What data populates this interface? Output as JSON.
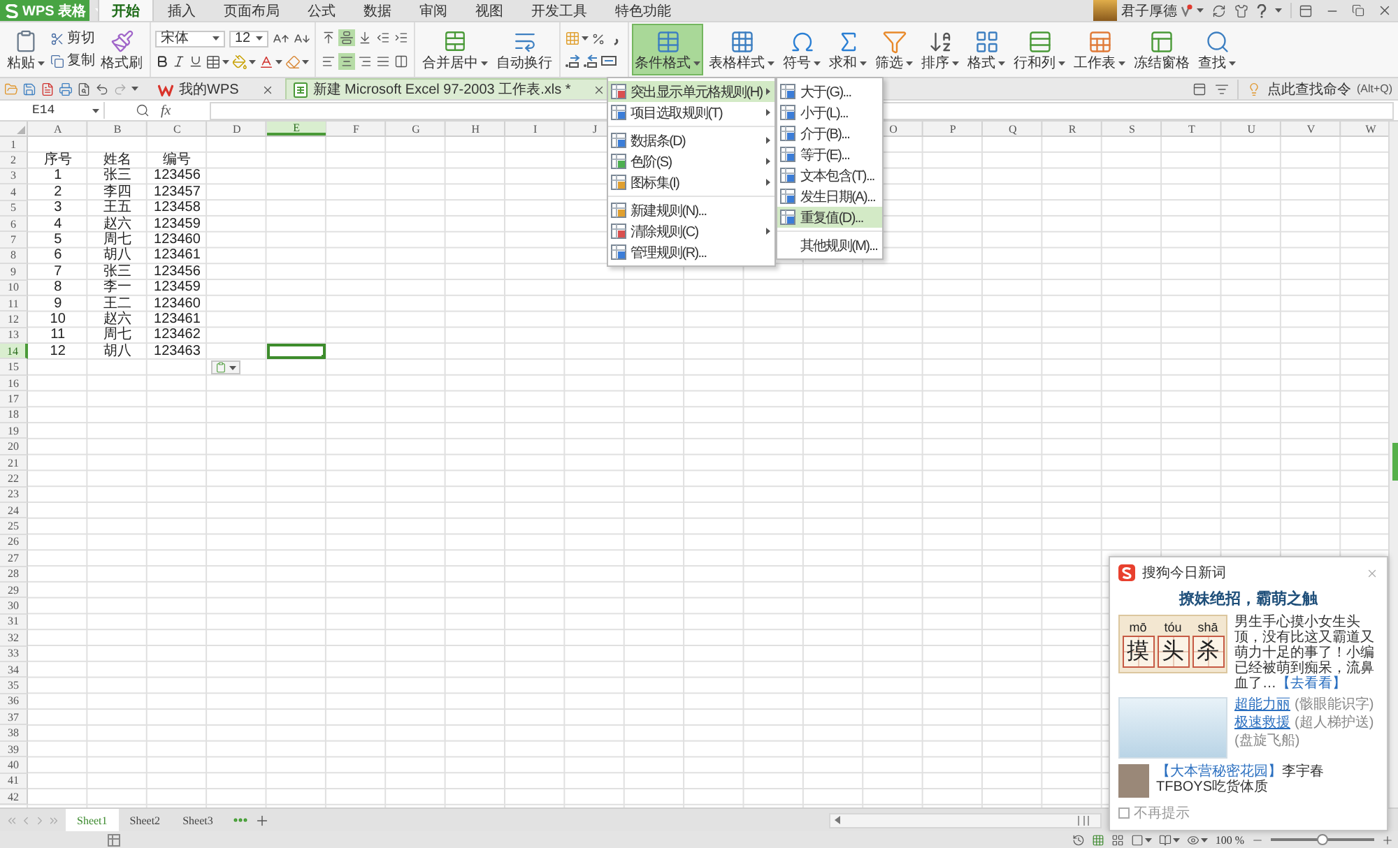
{
  "app_button": {
    "label": "WPS 表格"
  },
  "menu_tabs": [
    {
      "label": "开始",
      "selected": true
    },
    {
      "label": "插入",
      "selected": false
    },
    {
      "label": "页面布局",
      "selected": false
    },
    {
      "label": "公式",
      "selected": false
    },
    {
      "label": "数据",
      "selected": false
    },
    {
      "label": "审阅",
      "selected": false
    },
    {
      "label": "视图",
      "selected": false
    },
    {
      "label": "开发工具",
      "selected": false
    },
    {
      "label": "特色功能",
      "selected": false
    }
  ],
  "account": {
    "name": "君子厚德"
  },
  "ribbon": {
    "paste": "粘贴",
    "cut": "剪切",
    "copy": "复制",
    "format_painter": "格式刷",
    "font_name": "宋体",
    "font_size": "12",
    "alignment_rows": [
      {
        "buttons": [
          {
            "kind": "top",
            "selected": false
          },
          {
            "kind": "middle",
            "selected": true
          },
          {
            "kind": "bottom",
            "selected": false
          },
          {
            "kind": "outdent",
            "selected": false
          },
          {
            "kind": "indent",
            "selected": false
          }
        ]
      },
      {
        "buttons": [
          {
            "kind": "left",
            "selected": false
          },
          {
            "kind": "center",
            "selected": true
          },
          {
            "kind": "right",
            "selected": false
          },
          {
            "kind": "justify",
            "selected": false
          },
          {
            "kind": "distribute",
            "selected": false
          }
        ]
      }
    ],
    "merge": "合并居中",
    "wrap": "自动换行",
    "tools": [
      {
        "kind": "conditional",
        "label": "条件格式",
        "selected": true,
        "dropdown": true
      },
      {
        "kind": "style",
        "label": "表格样式",
        "selected": false,
        "dropdown": true
      },
      {
        "kind": "symbol",
        "label": "符号",
        "selected": false,
        "dropdown": true
      },
      {
        "kind": "sum",
        "label": "求和",
        "selected": false,
        "dropdown": true
      },
      {
        "kind": "filter",
        "label": "筛选",
        "selected": false,
        "dropdown": true
      },
      {
        "kind": "sort",
        "label": "排序",
        "selected": false,
        "dropdown": true
      },
      {
        "kind": "format",
        "label": "格式",
        "selected": false,
        "dropdown": true
      },
      {
        "kind": "rowcol",
        "label": "行和列",
        "selected": false,
        "dropdown": true
      },
      {
        "kind": "sheet",
        "label": "工作表",
        "selected": false,
        "dropdown": true
      },
      {
        "kind": "freeze",
        "label": "冻结窗格",
        "selected": false,
        "dropdown": false
      },
      {
        "kind": "find",
        "label": "查找",
        "selected": false,
        "dropdown": true
      }
    ]
  },
  "doc_tabs": [
    {
      "kind": "home",
      "label": "我的WPS",
      "selected": false
    },
    {
      "kind": "sheet",
      "label": "新建 Microsoft Excel 97-2003 工作表.xls *",
      "selected": true
    }
  ],
  "command_search": {
    "label": "点此查找命令",
    "shortcut": "(Alt+Q)"
  },
  "formula_bar": {
    "cell_name": "E14",
    "function_button": "fx"
  },
  "sheet": {
    "columns_left_of_menu": [
      {
        "label": "A",
        "selected": false
      },
      {
        "label": "B",
        "selected": false
      },
      {
        "label": "C",
        "selected": false
      },
      {
        "label": "D",
        "selected": false
      },
      {
        "label": "E",
        "selected": true
      },
      {
        "label": "F",
        "selected": false
      },
      {
        "label": "G",
        "selected": false
      },
      {
        "label": "H",
        "selected": false
      },
      {
        "label": "I",
        "selected": false
      },
      {
        "label": "J",
        "selected": false
      }
    ],
    "columns_right_of_menu": [
      {
        "label": "O",
        "selected": false
      },
      {
        "label": "P",
        "selected": false
      },
      {
        "label": "Q",
        "selected": false
      },
      {
        "label": "R",
        "selected": false
      },
      {
        "label": "S",
        "selected": false
      },
      {
        "label": "T",
        "selected": false
      },
      {
        "label": "U",
        "selected": false
      },
      {
        "label": "V",
        "selected": false
      },
      {
        "label": "W",
        "selected": false
      }
    ],
    "rows": [
      {
        "number": "1",
        "selected": false
      },
      {
        "number": "2",
        "selected": false,
        "cells": [
          "序号",
          "姓名",
          "编号"
        ]
      },
      {
        "number": "3",
        "selected": false,
        "cells": [
          "1",
          "张三",
          "123456"
        ]
      },
      {
        "number": "4",
        "selected": false,
        "cells": [
          "2",
          "李四",
          "123457"
        ]
      },
      {
        "number": "5",
        "selected": false,
        "cells": [
          "3",
          "王五",
          "123458"
        ]
      },
      {
        "number": "6",
        "selected": false,
        "cells": [
          "4",
          "赵六",
          "123459"
        ]
      },
      {
        "number": "7",
        "selected": false,
        "cells": [
          "5",
          "周七",
          "123460"
        ]
      },
      {
        "number": "8",
        "selected": false,
        "cells": [
          "6",
          "胡八",
          "123461"
        ]
      },
      {
        "number": "9",
        "selected": false,
        "cells": [
          "7",
          "张三",
          "123456"
        ]
      },
      {
        "number": "10",
        "selected": false,
        "cells": [
          "8",
          "李一",
          "123459"
        ]
      },
      {
        "number": "11",
        "selected": false,
        "cells": [
          "9",
          "王二",
          "123460"
        ]
      },
      {
        "number": "12",
        "selected": false,
        "cells": [
          "10",
          "赵六",
          "123461"
        ]
      },
      {
        "number": "13",
        "selected": false,
        "cells": [
          "11",
          "周七",
          "123462"
        ]
      },
      {
        "number": "14",
        "selected": true,
        "cells": [
          "12",
          "胡八",
          "123463"
        ]
      },
      {
        "number": "15",
        "selected": false
      },
      {
        "number": "16",
        "selected": false
      },
      {
        "number": "17",
        "selected": false
      },
      {
        "number": "18",
        "selected": false
      },
      {
        "number": "19",
        "selected": false
      },
      {
        "number": "20",
        "selected": false
      },
      {
        "number": "21",
        "selected": false
      },
      {
        "number": "22",
        "selected": false
      },
      {
        "number": "23",
        "selected": false
      },
      {
        "number": "24",
        "selected": false
      },
      {
        "number": "25",
        "selected": false
      },
      {
        "number": "26",
        "selected": false
      },
      {
        "number": "27",
        "selected": false
      },
      {
        "number": "28",
        "selected": false
      },
      {
        "number": "29",
        "selected": false
      },
      {
        "number": "30",
        "selected": false
      },
      {
        "number": "31",
        "selected": false
      },
      {
        "number": "32",
        "selected": false
      },
      {
        "number": "33",
        "selected": false
      },
      {
        "number": "34",
        "selected": false
      },
      {
        "number": "35",
        "selected": false
      },
      {
        "number": "36",
        "selected": false
      },
      {
        "number": "37",
        "selected": false
      },
      {
        "number": "38",
        "selected": false
      },
      {
        "number": "39",
        "selected": false
      },
      {
        "number": "40",
        "selected": false
      },
      {
        "number": "41",
        "selected": false
      },
      {
        "number": "42",
        "selected": false
      }
    ]
  },
  "conditional_format_menu": {
    "sections": [
      {
        "items": [
          {
            "kind": "highlight",
            "label": "突出显示单元格规则(H)",
            "submenu": true,
            "selected": true
          },
          {
            "kind": "topbottom",
            "label": "项目选取规则(T)",
            "submenu": true,
            "selected": false
          }
        ]
      },
      {
        "items": [
          {
            "kind": "databar",
            "label": "数据条(D)",
            "submenu": true,
            "selected": false
          },
          {
            "kind": "colorscale",
            "label": "色阶(S)",
            "submenu": true,
            "selected": false
          },
          {
            "kind": "iconset",
            "label": "图标集(I)",
            "submenu": true,
            "selected": false
          }
        ]
      },
      {
        "items": [
          {
            "kind": "new",
            "label": "新建规则(N)...",
            "submenu": false,
            "selected": false
          },
          {
            "kind": "clear",
            "label": "清除规则(C)",
            "submenu": true,
            "selected": false
          },
          {
            "kind": "manage",
            "label": "管理规则(R)...",
            "submenu": false,
            "selected": false
          }
        ]
      }
    ]
  },
  "highlight_rules_menu": {
    "sections": [
      {
        "items": [
          {
            "kind": "greater",
            "label": "大于(G)...",
            "selected": false
          },
          {
            "kind": "less",
            "label": "小于(L)...",
            "selected": false
          },
          {
            "kind": "between",
            "label": "介于(B)...",
            "selected": false
          },
          {
            "kind": "equal",
            "label": "等于(E)...",
            "selected": false
          },
          {
            "kind": "text",
            "label": "文本包含(T)...",
            "selected": false
          },
          {
            "kind": "date",
            "label": "发生日期(A)...",
            "selected": false
          },
          {
            "kind": "duplicate",
            "label": "重复值(D)...",
            "selected": true
          }
        ]
      },
      {
        "items": [
          {
            "kind": "other",
            "label": "其他规则(M)...",
            "selected": false
          }
        ]
      }
    ]
  },
  "sheet_tabs": [
    {
      "label": "Sheet1",
      "selected": true
    },
    {
      "label": "Sheet2",
      "selected": false
    },
    {
      "label": "Sheet3",
      "selected": false
    }
  ],
  "status_bar": {
    "zoom": "100 %",
    "level": 0.5
  },
  "news_popup": {
    "title": "搜狗今日新词",
    "headline": "撩妹绝招，霸萌之触",
    "card": [
      {
        "pinyin": "mō",
        "char": "摸"
      },
      {
        "pinyin": "tóu",
        "char": "头"
      },
      {
        "pinyin": "shā",
        "char": "杀"
      }
    ],
    "summary": "男生手心摸小女生头顶，没有比这又霸道又萌力十足的事了！小编已经被萌到痴呆，流鼻血了…",
    "more_link": "【去看看】",
    "links": [
      {
        "title": "超能力丽",
        "note": "(骸眼能识字)"
      },
      {
        "title": "极速救援",
        "note": "(超人梯护送)"
      },
      {
        "note": "(盘旋飞船)"
      }
    ],
    "story": {
      "link": "【大本营秘密花园】",
      "text": "李宇春TFBOYS吃货体质"
    },
    "dismiss": {
      "label": "不再提示",
      "checked": false
    }
  }
}
